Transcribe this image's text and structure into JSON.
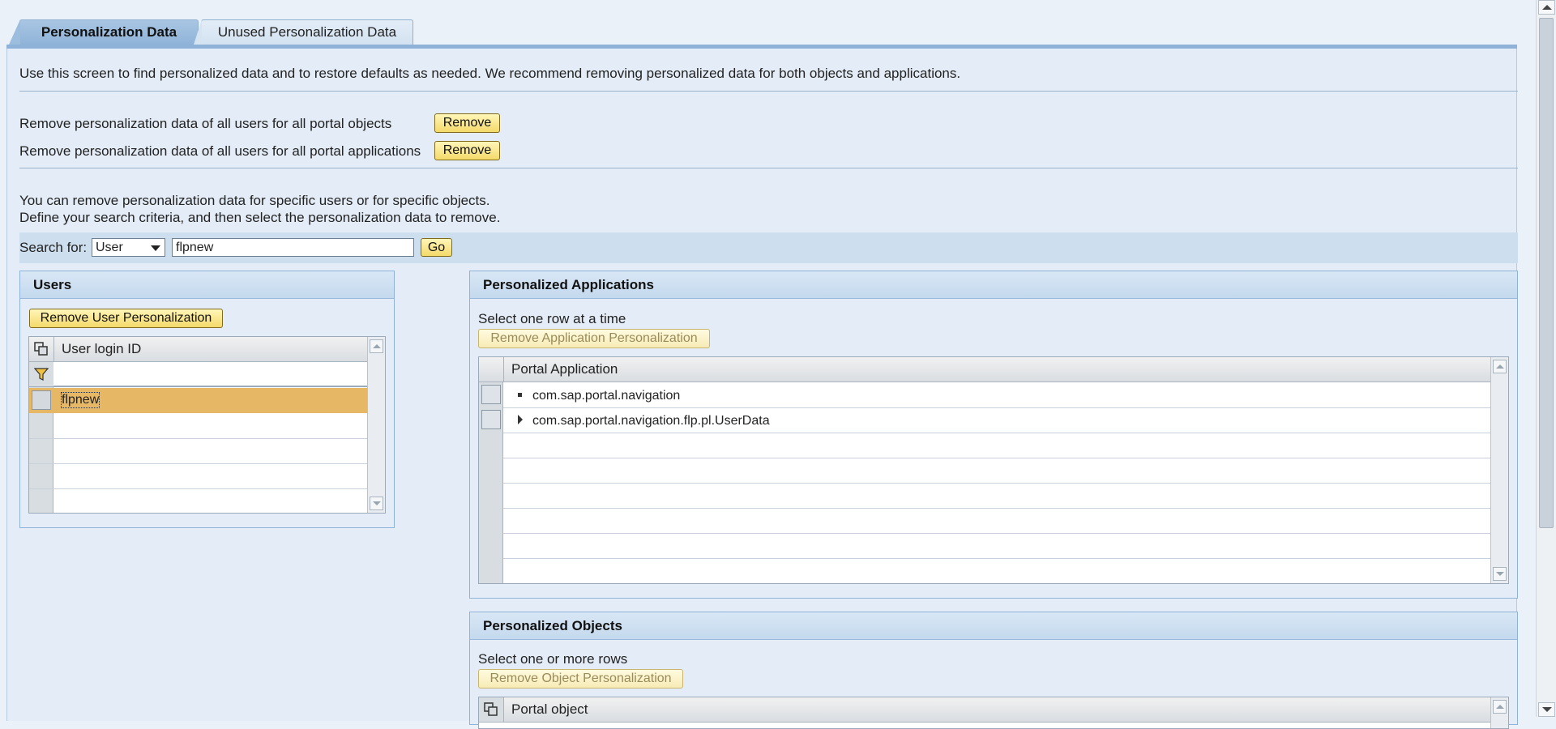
{
  "tabs": [
    {
      "label": "Personalization Data",
      "active": true
    },
    {
      "label": "Unused Personalization Data",
      "active": false
    }
  ],
  "intro": "Use this screen to find personalized data and to restore defaults as needed. We recommend removing personalized data for both objects and applications.",
  "global_remove": [
    {
      "label": "Remove personalization data of all users for all portal objects",
      "button": "Remove"
    },
    {
      "label": "Remove personalization data of all users for all portal applications",
      "button": "Remove"
    }
  ],
  "specific_info": [
    "You can remove personalization data for specific users or for specific objects.",
    "Define your search criteria, and then select the personalization data to remove."
  ],
  "search": {
    "label": "Search for:",
    "type_value": "User",
    "query_value": "flpnew",
    "go_label": "Go"
  },
  "users_panel": {
    "title": "Users",
    "remove_button": "Remove User Personalization",
    "column_header": "User login ID",
    "rows": [
      "flpnew"
    ]
  },
  "applications_panel": {
    "title": "Personalized Applications",
    "hint": "Select one row at a time",
    "remove_button": "Remove Application Personalization",
    "column_header": "Portal Application",
    "rows": [
      {
        "label": "com.sap.portal.navigation",
        "expander": "leaf"
      },
      {
        "label": "com.sap.portal.navigation.flp.pl.UserData",
        "expander": "collapsed"
      }
    ]
  },
  "objects_panel": {
    "title": "Personalized Objects",
    "hint": "Select one or more rows",
    "remove_button": "Remove Object Personalization",
    "column_header": "Portal object"
  },
  "colors": {
    "button_yellow": "#f4d96a",
    "selected_row": "#e6b866",
    "panel_header": "#c4d9ee",
    "tab_active": "#8fb3d8"
  }
}
